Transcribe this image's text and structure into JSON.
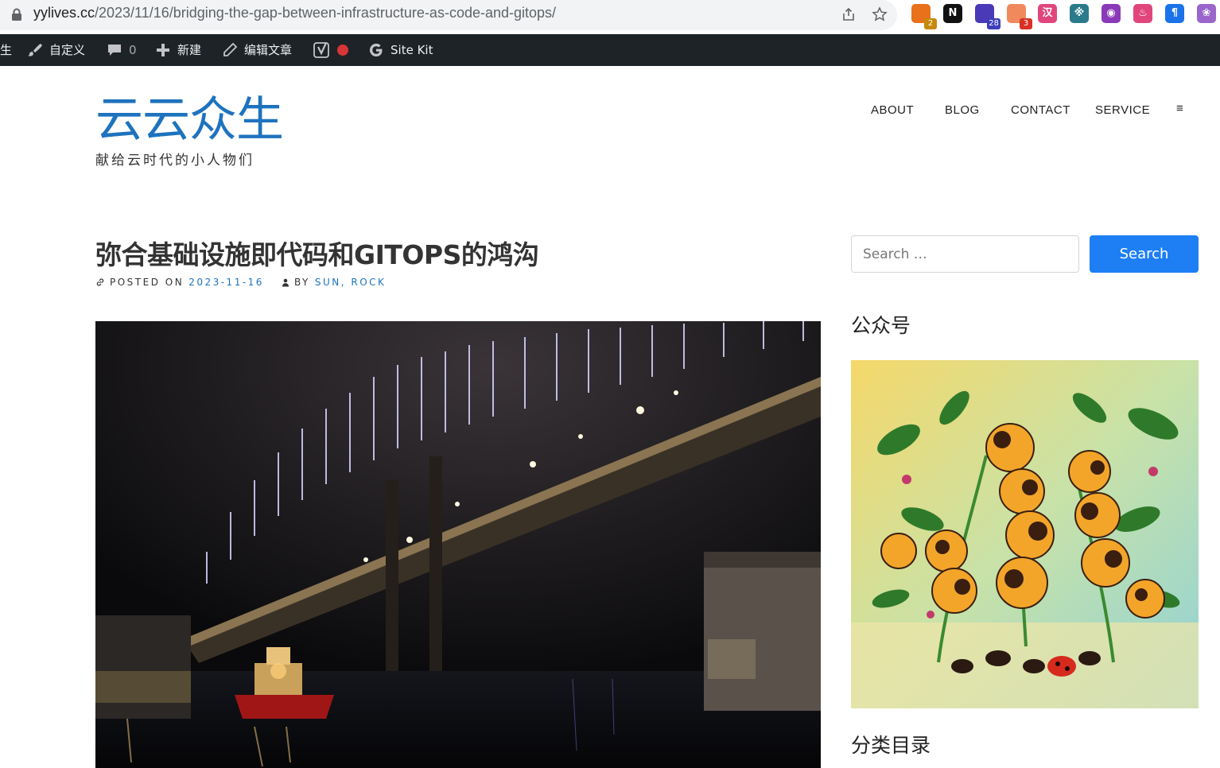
{
  "browser": {
    "url_host": "yylives.cc",
    "url_path": "/2023/11/16/bridging-the-gap-between-infrastructure-as-code-and-gitops/",
    "extensions": [
      {
        "name": "extension-1",
        "badge": "2",
        "color": "#e8711a",
        "badge_color": "#c5890a"
      },
      {
        "name": "notion-extension",
        "glyph": "N",
        "color": "#111111"
      },
      {
        "name": "extension-3",
        "badge": "28",
        "color": "#4a3ab8",
        "badge_color": "#3d3dbd"
      },
      {
        "name": "extension-4",
        "badge": "3",
        "color": "#f08a5d",
        "badge_color": "#d93025"
      },
      {
        "name": "translate-extension",
        "glyph": "汉",
        "color": "#e0457b"
      },
      {
        "name": "extension-6",
        "glyph": "※",
        "color": "#2a7a8c"
      },
      {
        "name": "extension-7",
        "glyph": "◉",
        "color": "#8a3ab8"
      },
      {
        "name": "extension-8",
        "glyph": "♨",
        "color": "#e0457b"
      },
      {
        "name": "extension-9",
        "glyph": "¶",
        "color": "#1a73e8"
      },
      {
        "name": "extension-10",
        "glyph": "❀",
        "color": "#9a66cc"
      }
    ]
  },
  "admin_bar": {
    "site_fragment": "生",
    "customize": "自定义",
    "comments_count": "0",
    "new": "新建",
    "edit_post": "编辑文章",
    "site_kit": "Site Kit"
  },
  "site": {
    "title": "云云众生",
    "tagline": "献给云时代的小人物们",
    "title_color": "#1e73be"
  },
  "nav": {
    "items": [
      "ABOUT",
      "BLOG",
      "CONTACT",
      "SERVICE"
    ],
    "menu_icon": "≡"
  },
  "post": {
    "title": "弥合基础设施即代码和GITOPS的鸿沟",
    "posted_on_label": "POSTED ON",
    "date": "2023-11-16",
    "by_label": "BY",
    "authors": "SUN, ROCK"
  },
  "sidebar": {
    "search_placeholder": "Search …",
    "search_button": "Search",
    "wechat_title": "公众号",
    "categories_title": "分类目录"
  }
}
